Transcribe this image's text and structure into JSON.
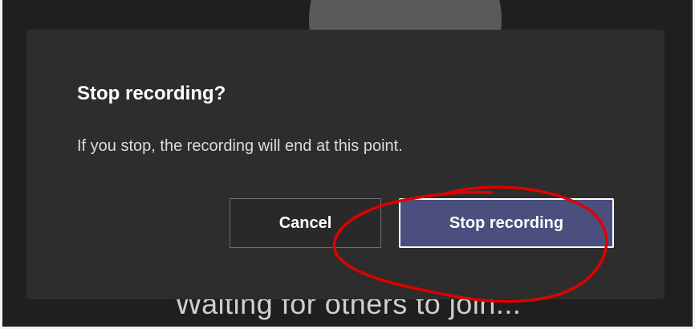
{
  "background": {
    "status_text": "Waiting for others to join..."
  },
  "dialog": {
    "title": "Stop recording?",
    "message": "If you stop, the recording will end at this point.",
    "buttons": {
      "cancel_label": "Cancel",
      "confirm_label": "Stop recording"
    }
  },
  "colors": {
    "overlay_background": "#1f1f1f",
    "dialog_background": "#2d2d2d",
    "primary_button": "#4b4f7e",
    "annotation_stroke": "#e00000"
  },
  "annotation": {
    "shape": "hand-drawn-circle",
    "target": "stop-recording-button"
  }
}
